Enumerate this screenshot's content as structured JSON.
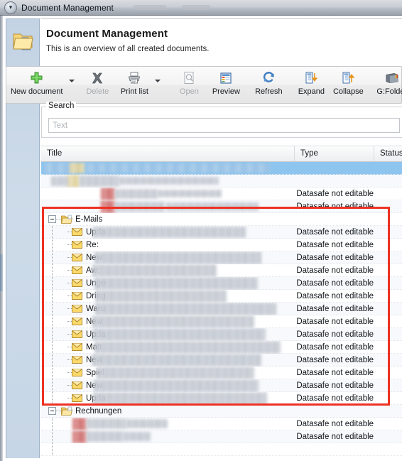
{
  "window": {
    "title": "Document Management",
    "back_icon": "back-chevron-icon"
  },
  "nav": {
    "icon": "documents-folder-icon"
  },
  "page": {
    "title": "Document Management",
    "subtitle": "This is an overview of all created documents."
  },
  "toolbar": {
    "items": [
      {
        "label": "New document",
        "icon": "plus-icon",
        "disabled": false,
        "caret": true
      },
      {
        "label": "Delete",
        "icon": "delete-x-icon",
        "disabled": true,
        "caret": false
      },
      {
        "label": "Print list",
        "icon": "printer-icon",
        "disabled": false,
        "caret": true
      },
      {
        "label": "Open",
        "icon": "open-doc-icon",
        "disabled": true,
        "caret": false
      },
      {
        "label": "Preview",
        "icon": "preview-icon",
        "disabled": false,
        "caret": false
      },
      {
        "label": "Refresh",
        "icon": "refresh-icon",
        "disabled": false,
        "caret": false
      },
      {
        "label": "Expand",
        "icon": "expand-tree-icon",
        "disabled": false,
        "caret": false
      },
      {
        "label": "Collapse",
        "icon": "collapse-tree-icon",
        "disabled": false,
        "caret": false
      },
      {
        "label": "G:Folder",
        "icon": "folder-book-icon",
        "disabled": false,
        "caret": true
      }
    ]
  },
  "search": {
    "legend": "Search",
    "placeholder": "Text",
    "value": ""
  },
  "grid": {
    "columns": [
      "Title",
      "Type",
      "Status"
    ],
    "type_value": "Datasafe not editable",
    "rows": [
      {
        "kind": "redacted",
        "title": "",
        "type": "",
        "selected": true,
        "alt": false
      },
      {
        "kind": "redacted",
        "title": "",
        "type": "",
        "selected": false,
        "alt": true
      },
      {
        "kind": "redacted",
        "title": "",
        "type": "Datasafe not editable",
        "selected": false,
        "alt": false
      },
      {
        "kind": "redacted",
        "title": "",
        "type": "Datasafe not editable",
        "selected": false,
        "alt": true
      },
      {
        "kind": "folder",
        "title": "E-Mails",
        "type": "",
        "selected": false,
        "alt": false
      },
      {
        "kind": "mail",
        "title": "Upda",
        "type": "Datasafe not editable",
        "selected": false,
        "alt": true
      },
      {
        "kind": "mail",
        "title": "Re:",
        "type": "Datasafe not editable",
        "selected": false,
        "alt": false
      },
      {
        "kind": "mail",
        "title": "New",
        "type": "Datasafe not editable",
        "selected": false,
        "alt": true
      },
      {
        "kind": "mail",
        "title": "Aw:",
        "type": "Datasafe not editable",
        "selected": false,
        "alt": false
      },
      {
        "kind": "mail",
        "title": "Unge",
        "type": "Datasafe not editable",
        "selected": false,
        "alt": true
      },
      {
        "kind": "mail",
        "title": "Dring",
        "type": "Datasafe not editable",
        "selected": false,
        "alt": false
      },
      {
        "kind": "mail",
        "title": "Waru",
        "type": "Datasafe not editable",
        "selected": false,
        "alt": true
      },
      {
        "kind": "mail",
        "title": "New",
        "type": "Datasafe not editable",
        "selected": false,
        "alt": false
      },
      {
        "kind": "mail",
        "title": "Upda",
        "type": "Datasafe not editable",
        "selected": false,
        "alt": true
      },
      {
        "kind": "mail",
        "title": "Matt",
        "type": "Datasafe not editable",
        "selected": false,
        "alt": false
      },
      {
        "kind": "mail",
        "title": "New",
        "type": "Datasafe not editable",
        "selected": false,
        "alt": true
      },
      {
        "kind": "mail",
        "title": "Spiel",
        "type": "Datasafe not editable",
        "selected": false,
        "alt": false
      },
      {
        "kind": "mail",
        "title": "New",
        "type": "Datasafe not editable",
        "selected": false,
        "alt": true
      },
      {
        "kind": "mail",
        "title": "Upda",
        "type": "Datasafe not editable",
        "selected": false,
        "alt": false
      },
      {
        "kind": "folder",
        "title": "Rechnungen",
        "type": "",
        "selected": false,
        "alt": true
      },
      {
        "kind": "redacted",
        "title": "",
        "type": "Datasafe not editable",
        "selected": false,
        "alt": false
      },
      {
        "kind": "redacted",
        "title": "",
        "type": "Datasafe not editable",
        "selected": false,
        "alt": true
      },
      {
        "kind": "blank",
        "title": "",
        "type": "",
        "selected": false,
        "alt": false
      }
    ]
  },
  "annotation": {
    "highlight_color": "#ee3124",
    "shape": "rectangle"
  }
}
